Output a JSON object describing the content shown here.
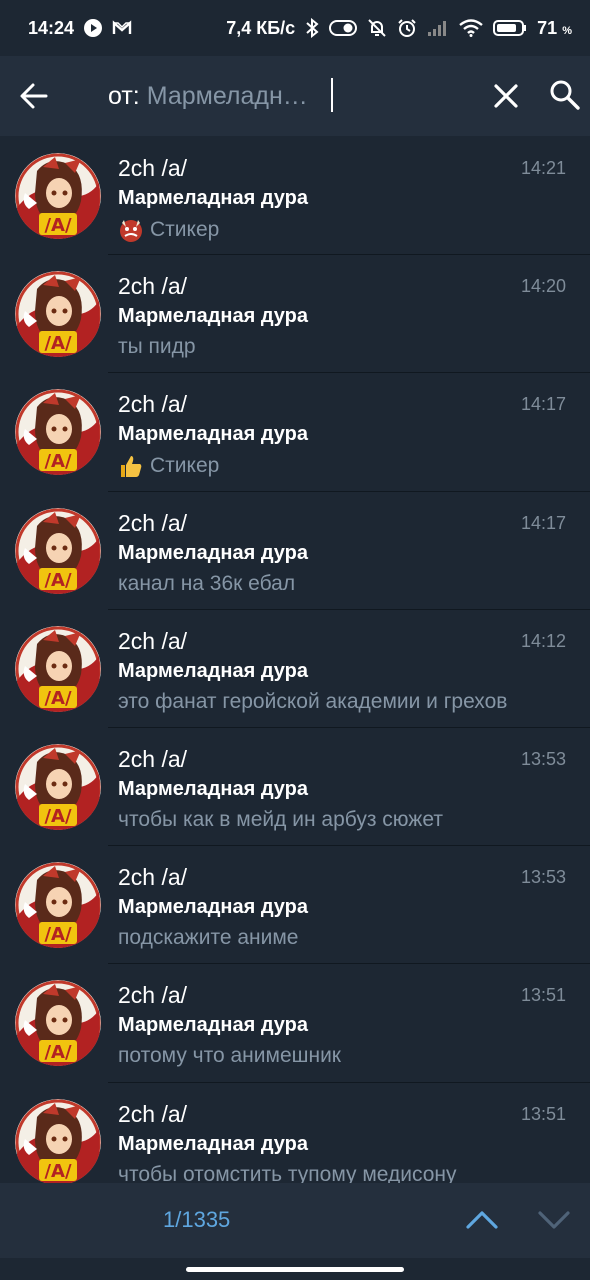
{
  "status_bar": {
    "time": "14:24",
    "network_speed": "7,4 КБ/с",
    "battery_percent": "71",
    "battery_suffix": "%"
  },
  "search": {
    "prefix": "от:",
    "sender_filter": "Мармеладн…"
  },
  "results": [
    {
      "chat": "2ch /a/",
      "sender": "Мармеладная дура",
      "time": "14:21",
      "emoji": "ogre-emoji",
      "message": "Стикер"
    },
    {
      "chat": "2ch /a/",
      "sender": "Мармеладная дура",
      "time": "14:20",
      "emoji": "",
      "message": "ты пидр"
    },
    {
      "chat": "2ch /a/",
      "sender": "Мармеладная дура",
      "time": "14:17",
      "emoji": "thumbs-up-emoji",
      "message": "Стикер"
    },
    {
      "chat": "2ch /a/",
      "sender": "Мармеладная дура",
      "time": "14:17",
      "emoji": "",
      "message": "канал на 36к ебал"
    },
    {
      "chat": "2ch /a/",
      "sender": "Мармеладная дура",
      "time": "14:12",
      "emoji": "",
      "message": "это фанат геройской академии и грехов"
    },
    {
      "chat": "2ch /a/",
      "sender": "Мармеладная дура",
      "time": "13:53",
      "emoji": "",
      "message": "чтобы как в мейд ин арбуз сюжет"
    },
    {
      "chat": "2ch /a/",
      "sender": "Мармеладная дура",
      "time": "13:53",
      "emoji": "",
      "message": "подскажите аниме"
    },
    {
      "chat": "2ch /a/",
      "sender": "Мармеладная дура",
      "time": "13:51",
      "emoji": "",
      "message": "потому что анимешник"
    },
    {
      "chat": "2ch /a/",
      "sender": "Мармеладная дура",
      "time": "13:51",
      "emoji": "",
      "message": "чтобы отомстить тупому медисону"
    }
  ],
  "navigation": {
    "counter": "1/1335"
  },
  "colors": {
    "background": "#1d2733",
    "header": "#242f3d",
    "accent": "#5fa7e0",
    "secondary_text": "#8696a6"
  }
}
